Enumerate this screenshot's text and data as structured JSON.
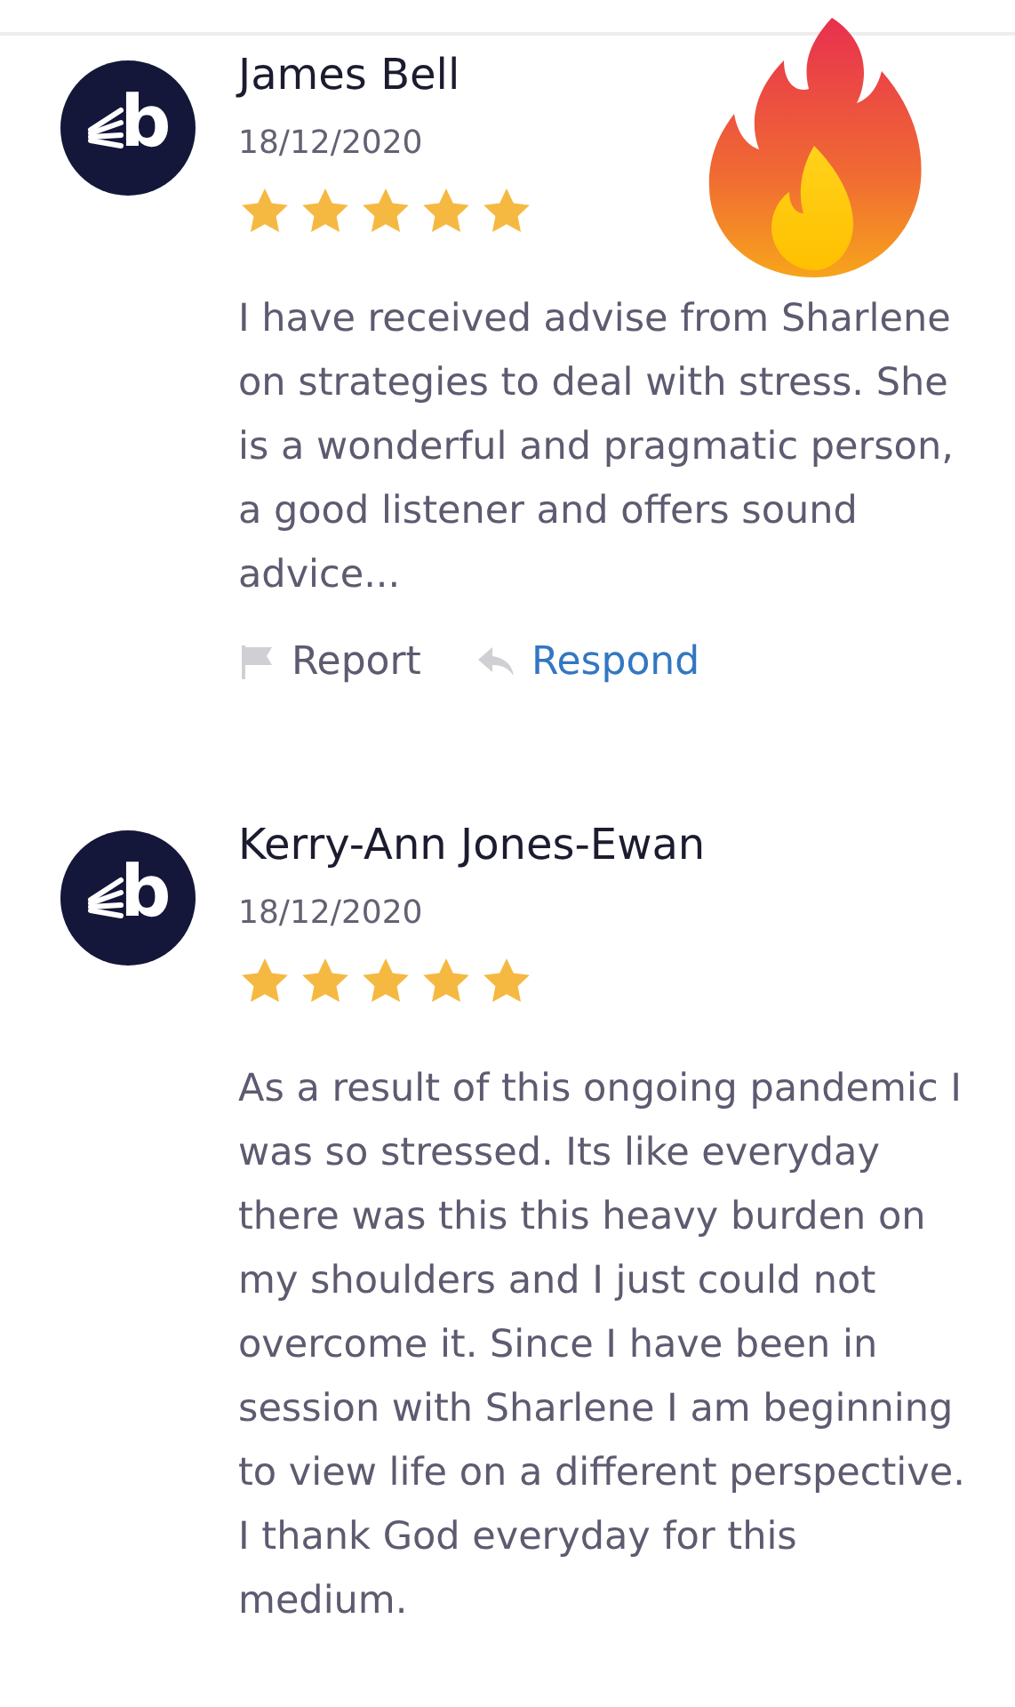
{
  "reviews": [
    {
      "logo": "b",
      "name": "James Bell",
      "date": "18/12/2020",
      "stars": 5,
      "text": "I have received advise from Sharlene on strategies to deal with stress.  She is a wonderful and pragmatic person, a good listener and offers sound advice...",
      "actions": [
        {
          "kind": "report",
          "label": "Report"
        },
        {
          "kind": "respond",
          "label": "Respond"
        }
      ]
    },
    {
      "logo": "b",
      "name": "Kerry-Ann Jones-Ewan",
      "date": "18/12/2020",
      "stars": 5,
      "text": "As a result of this ongoing pandemic I was so stressed. Its like everyday there was this this heavy burden on my shoulders and I just could not overcome it. Since I have been in session with Sharlene I am beginning to view life on a different perspective.\nI thank God everyday for this medium."
    }
  ]
}
